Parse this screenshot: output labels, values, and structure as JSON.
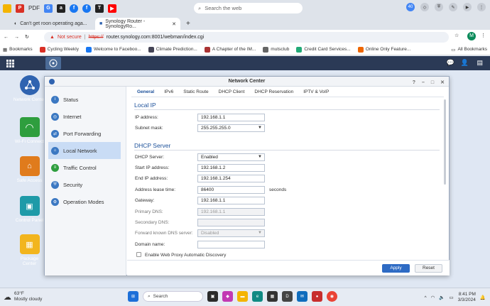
{
  "browser": {
    "top_items": [
      "PDF",
      "Search the web"
    ],
    "tabs": [
      {
        "label": "Can't get roon operating aga..."
      },
      {
        "label": "Synology Router - SynologyRo..."
      }
    ],
    "new_tab": "+",
    "not_secure": "Not secure",
    "url_scheme": "https://",
    "url_rest": "router.synology.com:8001/webman/index.cgi",
    "profile_initial": "M",
    "badge_count": "40",
    "bookmarks": [
      "Bookmarks",
      "Cycling Weekly",
      "Welcome to Faceboo...",
      "Climate Prediction...",
      "A Chapter of the IM...",
      "mutsclub",
      "Credit Card Services...",
      "Online Only Feature...",
      "All Bookmarks"
    ]
  },
  "desktop": {
    "icons": [
      {
        "label": "Network Center",
        "color": "#2f63b0"
      },
      {
        "label": "Wi-Fi Connect",
        "color": "#2e9e3e"
      },
      {
        "label": "Safe Access",
        "color": "#e07b1c"
      },
      {
        "label": "Control Panel",
        "color": "#1e9aa8"
      },
      {
        "label": "Package Center",
        "color": "#f2b51e"
      }
    ]
  },
  "window": {
    "title": "Network Center",
    "controls": [
      "?",
      "–",
      "□",
      "✕"
    ],
    "sidebar": [
      {
        "label": "Status"
      },
      {
        "label": "Internet"
      },
      {
        "label": "Port Forwarding"
      },
      {
        "label": "Local Network"
      },
      {
        "label": "Traffic Control"
      },
      {
        "label": "Security"
      },
      {
        "label": "Operation Modes"
      }
    ],
    "tabs": [
      "General",
      "IPv6",
      "Static Route",
      "DHCP Client",
      "DHCP Reservation",
      "IPTV & VoIP"
    ],
    "local_ip": {
      "heading": "Local IP",
      "ip_label": "IP address:",
      "ip_value": "192.168.1.1",
      "mask_label": "Subnet mask:",
      "mask_value": "255.255.255.0"
    },
    "dhcp": {
      "heading": "DHCP Server",
      "server_label": "DHCP Server:",
      "server_value": "Enabled",
      "start_label": "Start IP address:",
      "start_value": "192.168.1.2",
      "end_label": "End IP address:",
      "end_value": "192.168.1.254",
      "lease_label": "Address lease time:",
      "lease_value": "86400",
      "lease_unit": "seconds",
      "gateway_label": "Gateway:",
      "gateway_value": "192.168.1.1",
      "primary_dns_label": "Primary DNS:",
      "primary_dns_value": "192.168.1.1",
      "secondary_dns_label": "Secondary DNS:",
      "secondary_dns_value": "",
      "forward_label": "Forward known DNS server:",
      "forward_value": "Disabled",
      "domain_label": "Domain name:",
      "domain_value": "",
      "wpad_label": "Enable Web Proxy Automatic Discovery"
    },
    "apply_label": "Apply",
    "reset_label": "Reset"
  },
  "taskbar": {
    "temp": "63°F",
    "weather": "Mostly cloudy",
    "search_label": "Search",
    "time": "8:41 PM",
    "date": "3/3/2024"
  },
  "colors": {
    "accent": "#2e6bc4",
    "dsm_bar": "#2b3a56",
    "tab_active": "#1a4f99"
  }
}
